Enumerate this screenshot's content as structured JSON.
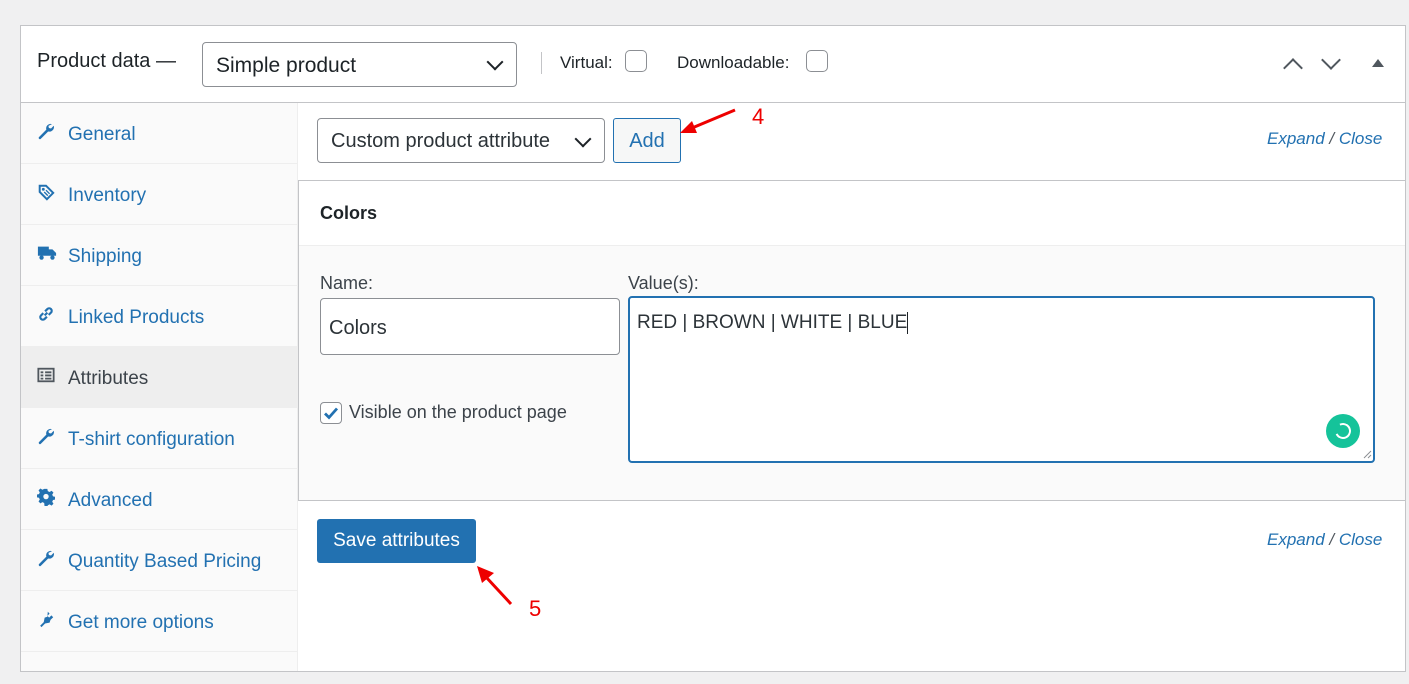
{
  "header": {
    "title": "Product data —",
    "product_type": "Simple product",
    "virtual_label": "Virtual:",
    "downloadable_label": "Downloadable:"
  },
  "sidebar": {
    "items": [
      {
        "label": "General",
        "icon": "wrench-icon",
        "active": false
      },
      {
        "label": "Inventory",
        "icon": "tag-icon",
        "active": false
      },
      {
        "label": "Shipping",
        "icon": "truck-icon",
        "active": false
      },
      {
        "label": "Linked Products",
        "icon": "link-icon",
        "active": false
      },
      {
        "label": "Attributes",
        "icon": "list-icon",
        "active": true
      },
      {
        "label": "T-shirt configuration",
        "icon": "wrench-icon",
        "active": false
      },
      {
        "label": "Advanced",
        "icon": "gear-icon",
        "active": false
      },
      {
        "label": "Quantity Based Pricing",
        "icon": "wrench-icon",
        "active": false
      },
      {
        "label": "Get more options",
        "icon": "plug-icon",
        "active": false
      }
    ]
  },
  "attributes": {
    "attribute_select": "Custom product attribute",
    "add_label": "Add",
    "expand_label": "Expand",
    "slash": "/",
    "close_label": "Close",
    "attribute_title": "Colors",
    "name_label": "Name:",
    "name_value": "Colors",
    "values_label": "Value(s):",
    "values_value": "RED | BROWN | WHITE | BLUE",
    "visible_label": "Visible on the product page",
    "visible_checked": true,
    "save_label": "Save attributes"
  },
  "annotations": {
    "step4": "4",
    "step5": "5"
  },
  "colors": {
    "accent": "#2271b1",
    "annotation": "#ee0000",
    "grammarly": "#15c39a"
  }
}
